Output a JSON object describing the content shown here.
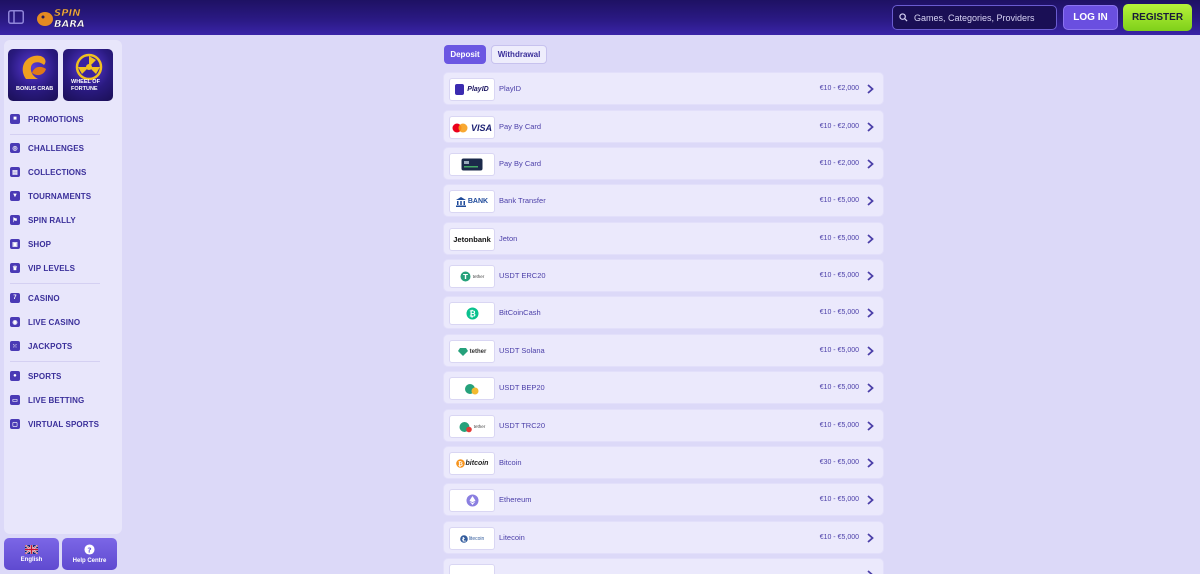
{
  "header": {
    "logo_text_top": "SPIN",
    "logo_text_bottom": "BARA",
    "search_placeholder": "Games, Categories, Providers",
    "login_label": "LOG IN",
    "register_label": "REGISTER"
  },
  "sidebar": {
    "promo_cards": [
      {
        "label": "BONUS CRAB",
        "icon": "crab-claw-icon"
      },
      {
        "label": "WHEEL OF FORTUNE",
        "icon": "wheel-icon"
      }
    ],
    "items": [
      {
        "label": "PROMOTIONS",
        "icon": "gift-icon"
      },
      {
        "label": "CHALLENGES",
        "icon": "target-icon"
      },
      {
        "label": "COLLECTIONS",
        "icon": "cards-icon"
      },
      {
        "label": "TOURNAMENTS",
        "icon": "trophy-icon"
      },
      {
        "label": "SPIN RALLY",
        "icon": "flag-icon"
      },
      {
        "label": "SHOP",
        "icon": "shop-icon"
      },
      {
        "label": "VIP LEVELS",
        "icon": "crown-icon"
      },
      {
        "label": "CASINO",
        "icon": "slot-icon"
      },
      {
        "label": "LIVE CASINO",
        "icon": "roulette-icon"
      },
      {
        "label": "JACKPOTS",
        "icon": "dice-icon"
      },
      {
        "label": "SPORTS",
        "icon": "ball-icon"
      },
      {
        "label": "LIVE BETTING",
        "icon": "ticket-icon"
      },
      {
        "label": "VIRTUAL SPORTS",
        "icon": "screen-icon"
      }
    ],
    "language_label": "English",
    "help_label": "Help Centre"
  },
  "tabs": {
    "deposit": "Deposit",
    "withdrawal": "Withdrawal"
  },
  "methods": [
    {
      "name": "PlayID",
      "range": "€10 - €2,000",
      "logo": "PlayID"
    },
    {
      "name": "Pay By Card",
      "range": "€10 - €2,000",
      "logo": "VISA"
    },
    {
      "name": "Pay By Card",
      "range": "€10 - €2,000",
      "logo": ""
    },
    {
      "name": "Bank Transfer",
      "range": "€10 - €5,000",
      "logo": "BANK"
    },
    {
      "name": "Jeton",
      "range": "€10 - €5,000",
      "logo": "Jetonbank"
    },
    {
      "name": "USDT ERC20",
      "range": "€10 - €5,000",
      "logo": "tether"
    },
    {
      "name": "BitCoinCash",
      "range": "€10 - €5,000",
      "logo": ""
    },
    {
      "name": "USDT Solana",
      "range": "€10 - €5,000",
      "logo": "tether"
    },
    {
      "name": "USDT BEP20",
      "range": "€10 - €5,000",
      "logo": ""
    },
    {
      "name": "USDT TRC20",
      "range": "€10 - €5,000",
      "logo": "tether"
    },
    {
      "name": "Bitcoin",
      "range": "€30 - €5,000",
      "logo": "bitcoin"
    },
    {
      "name": "Ethereum",
      "range": "€10 - €5,000",
      "logo": ""
    },
    {
      "name": "Litecoin",
      "range": "€10 - €5,000",
      "logo": "litecoin"
    }
  ]
}
